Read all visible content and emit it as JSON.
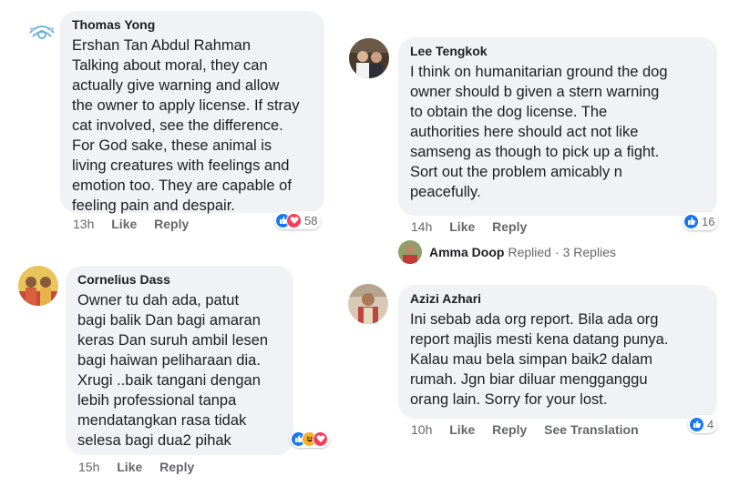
{
  "colors": {
    "like": "#1877f2",
    "love": "#f33e58",
    "haha": "#f7b125",
    "bubble": "#f0f2f5",
    "meta": "#65676b"
  },
  "comments": [
    {
      "author": "Thomas Yong",
      "text": "Ershan Tan Abdul Rahman\nTalking about moral, they can\nactually give warning and allow\nthe owner to apply license. If stray\ncat involved, see the difference.\nFor God sake, these animal is\nliving creatures with feelings and\nemotion too. They are capable of\nfeeling pain and despair.",
      "time": "13h",
      "like_label": "Like",
      "reply_label": "Reply",
      "reactions": [
        "like-icon",
        "love-icon"
      ],
      "reaction_count": "58"
    },
    {
      "author": "Lee Tengkok",
      "text": "I think on humanitarian ground the dog\nowner should b given a stern warning\nto obtain the dog license. The\nauthorities here should act not like\nsamseng as though to pick up a fight.\nSort out the problem amicably n\npeacefully.",
      "time": "14h",
      "like_label": "Like",
      "reply_label": "Reply",
      "reactions": [
        "like-icon"
      ],
      "reaction_count": "16",
      "replies": {
        "name": "Amma Doop",
        "replied": "Replied",
        "separator": "·",
        "count": "3 Replies"
      }
    },
    {
      "author": "Cornelius Dass",
      "text": "Owner tu dah ada, patut\nbagi balik Dan bagi amaran\nkeras Dan suruh ambil lesen\nbagi haiwan peliharaan dia.\nXrugi ..baik  tangani dengan\nlebih professional tanpa\nmendatangkan rasa tidak\nselesa  bagi dua2 pihak",
      "time": "15h",
      "like_label": "Like",
      "reply_label": "Reply",
      "reactions": [
        "like-icon",
        "haha-icon",
        "love-icon"
      ]
    },
    {
      "author": "Azizi Azhari",
      "text": "Ini sebab ada org report. Bila ada org\nreport majlis mesti kena datang punya.\nKalau mau bela simpan baik2 dalam\nrumah. Jgn biar  diluar mengganggu\norang lain. Sorry for your lost.",
      "time": "10h",
      "like_label": "Like",
      "reply_label": "Reply",
      "translate_label": "See Translation",
      "reactions": [
        "like-icon"
      ],
      "reaction_count": "4"
    }
  ]
}
